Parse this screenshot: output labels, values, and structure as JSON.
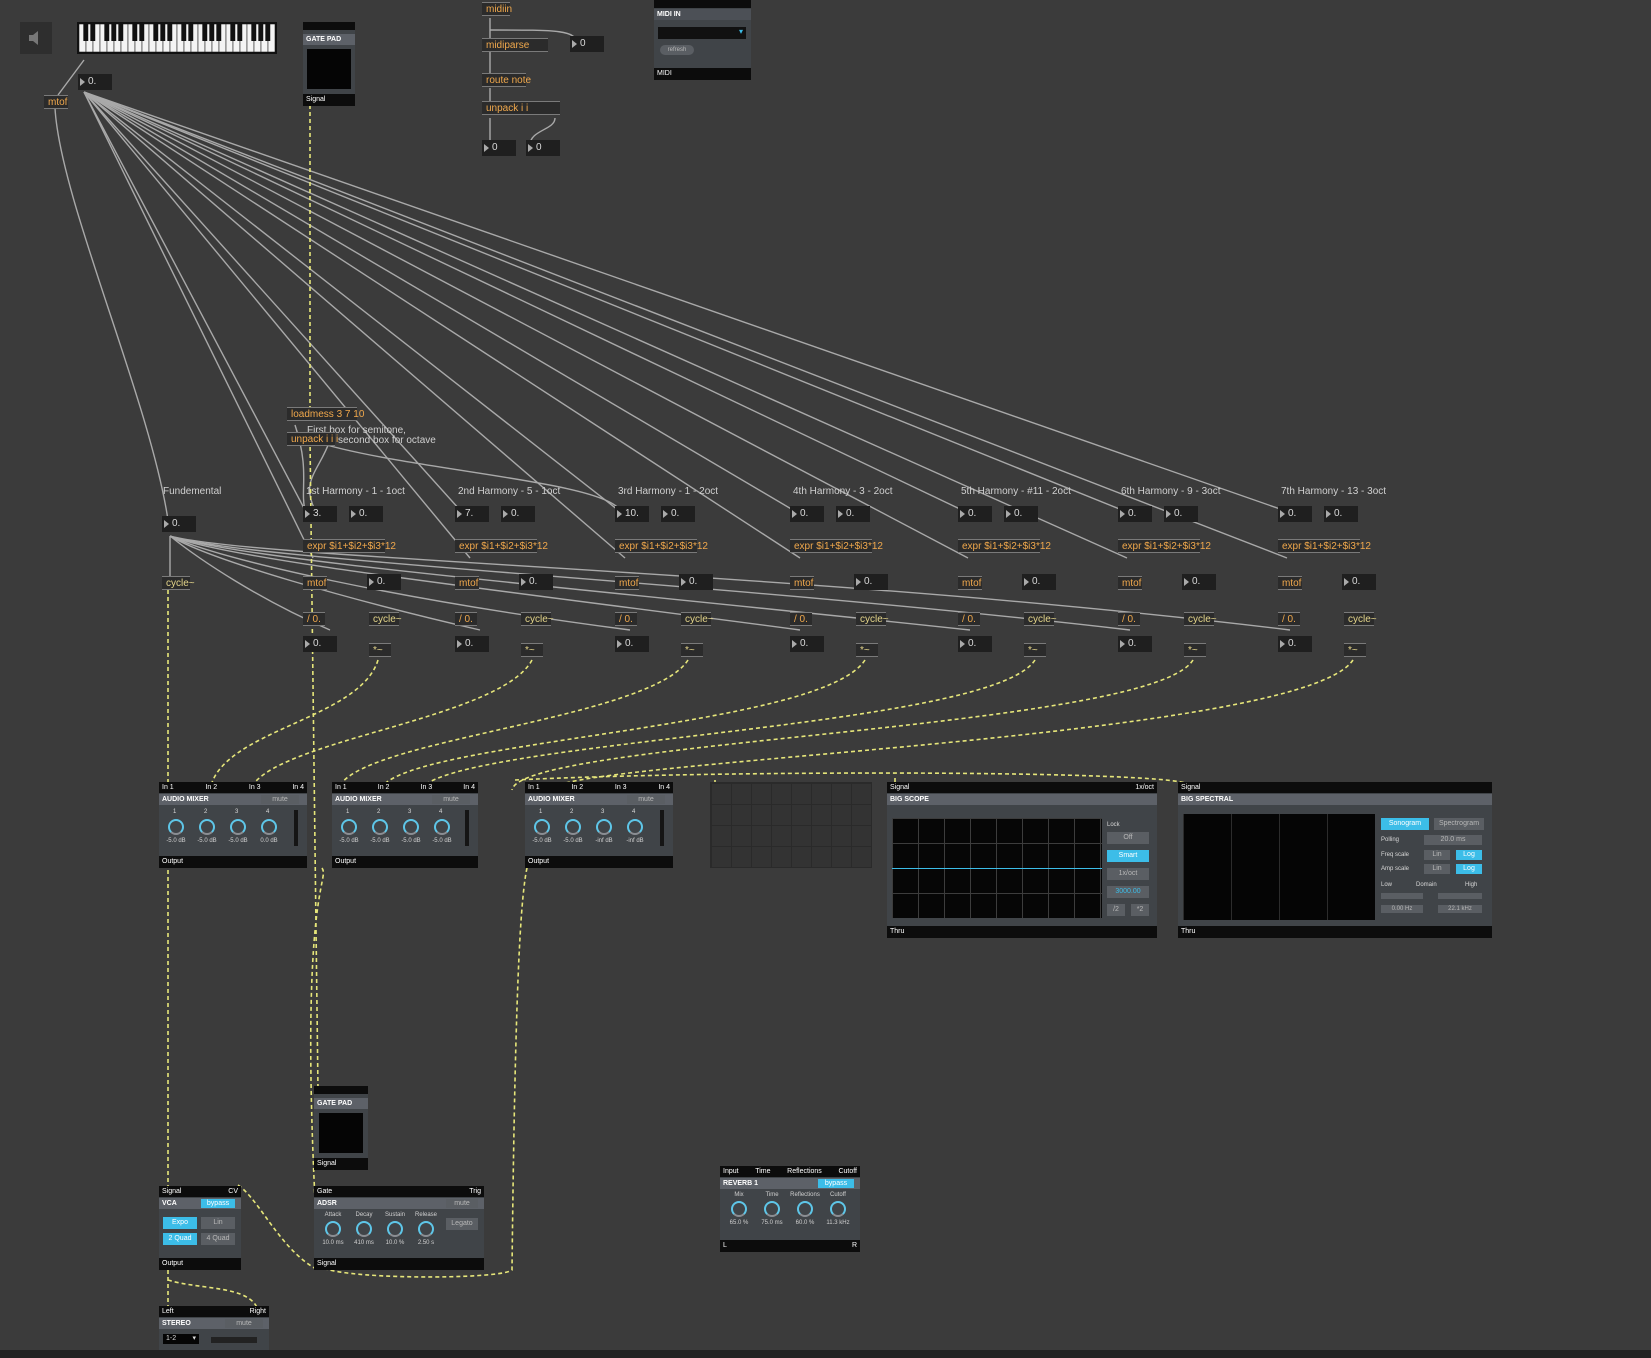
{
  "top": {
    "mtof_label": "mtof",
    "keyboard_num": "0.",
    "midiin": "midiin",
    "midiparse": "midiparse",
    "midiparse_out": "0",
    "route_note": "route note",
    "unpack": "unpack i i",
    "pitch_out": "0",
    "velocity_out": "0"
  },
  "midi_in_panel": {
    "title": "MIDI IN",
    "refresh": "refresh",
    "footer": "MIDI"
  },
  "gate_pad_top": {
    "title": "GATE PAD",
    "footer": "Signal"
  },
  "loadmess": "loadmess 3 7 10",
  "unpack_iii": "unpack i i i",
  "comment_semitone": "First box for semitone,",
  "comment_octave": "second box for octave",
  "fundamental": {
    "label": "Fundemental",
    "num": "0.",
    "cycle": "cycle~"
  },
  "harmonics": [
    {
      "label": "1st Harmony - 1 - 1oct",
      "semi": "3.",
      "oct": "0.",
      "expr": "expr $i1+$i2+$i3*12",
      "mtof": "mtof",
      "mnum": "0.",
      "div": "/ 0.",
      "cycle": "cycle~",
      "divnum": "0.",
      "mult": "*~"
    },
    {
      "label": "2nd Harmony - 5 - 1oct",
      "semi": "7.",
      "oct": "0.",
      "expr": "expr $i1+$i2+$i3*12",
      "mtof": "mtof",
      "mnum": "0.",
      "div": "/ 0.",
      "cycle": "cycle~",
      "divnum": "0.",
      "mult": "*~"
    },
    {
      "label": "3rd Harmony - 1 - 2oct",
      "semi": "10.",
      "oct": "0.",
      "expr": "expr $i1+$i2+$i3*12",
      "mtof": "mtof",
      "mnum": "0.",
      "div": "/ 0.",
      "cycle": "cycle~",
      "divnum": "0.",
      "mult": "*~"
    },
    {
      "label": "4th Harmony - 3 - 2oct",
      "semi": "0.",
      "oct": "0.",
      "expr": "expr $i1+$i2+$i3*12",
      "mtof": "mtof",
      "mnum": "0.",
      "div": "/ 0.",
      "cycle": "cycle~",
      "divnum": "0.",
      "mult": "*~"
    },
    {
      "label": "5th Harmony - #11 - 2oct",
      "semi": "0.",
      "oct": "0.",
      "expr": "expr $i1+$i2+$i3*12",
      "mtof": "mtof",
      "mnum": "0.",
      "div": "/ 0.",
      "cycle": "cycle~",
      "divnum": "0.",
      "mult": "*~"
    },
    {
      "label": "6th Harmony - 9 - 3oct",
      "semi": "0.",
      "oct": "0.",
      "expr": "expr $i1+$i2+$i3*12",
      "mtof": "mtof",
      "mnum": "0.",
      "div": "/ 0.",
      "cycle": "cycle~",
      "divnum": "0.",
      "mult": "*~"
    },
    {
      "label": "7th Harmony - 13 - 3oct",
      "semi": "0.",
      "oct": "0.",
      "expr": "expr $i1+$i2+$i3*12",
      "mtof": "mtof",
      "mnum": "0.",
      "div": "/ 0.",
      "cycle": "cycle~",
      "divnum": "0.",
      "mult": "*~"
    }
  ],
  "mixers": [
    {
      "inputs": [
        "In 1",
        "In 2",
        "In 3",
        "In 4"
      ],
      "title": "AUDIO MIXER",
      "mute": "mute",
      "channels": [
        "1",
        "2",
        "3",
        "4"
      ],
      "levels": [
        "-5.0 dB",
        "-5.0 dB",
        "-5.0 dB",
        "0.0 dB"
      ],
      "footer": "Output"
    },
    {
      "inputs": [
        "In 1",
        "In 2",
        "In 3",
        "In 4"
      ],
      "title": "AUDIO MIXER",
      "mute": "mute",
      "channels": [
        "1",
        "2",
        "3",
        "4"
      ],
      "levels": [
        "-5.0 dB",
        "-5.0 dB",
        "-5.0 dB",
        "-5.0 dB"
      ],
      "footer": "Output"
    },
    {
      "inputs": [
        "In 1",
        "In 2",
        "In 3",
        "In 4"
      ],
      "title": "AUDIO MIXER",
      "mute": "mute",
      "channels": [
        "1",
        "2",
        "3",
        "4"
      ],
      "levels": [
        "-5.0 dB",
        "-5.0 dB",
        "-inf dB",
        "-inf dB"
      ],
      "footer": "Output"
    }
  ],
  "scope": {
    "header_left": "Signal",
    "header_right": "1x/oct",
    "title": "BIG SCOPE",
    "lock": "Lock",
    "off": "Off",
    "smart": "Smart",
    "oct": "1x/oct",
    "value": "3000.00",
    "half": "/2",
    "double": "*2",
    "footer": "Thru",
    "accent": "#3cbde8"
  },
  "spectral": {
    "header_left": "Signal",
    "title": "BIG SPECTRAL",
    "sonogram": "Sonogram",
    "spectrogram": "Spectrogram",
    "polling": "Polling",
    "polling_value": "20.0 ms",
    "freq_scale": "Freq scale",
    "amp_scale": "Amp scale",
    "lin": "Lin",
    "log": "Log",
    "low": "Low",
    "domain": "Domain",
    "high": "High",
    "low_value": "0.00 Hz",
    "high_value": "22.1 kHz",
    "footer": "Thru"
  },
  "gate_pad_bottom": {
    "title": "GATE PAD",
    "footer": "Signal"
  },
  "vca": {
    "header_left": "Signal",
    "header_right": "CV",
    "title": "VCA",
    "bypass": "bypass",
    "expo": "Expo",
    "lin": "Lin",
    "quad2": "2 Quad",
    "quad4": "4 Quad",
    "footer": "Output"
  },
  "adsr": {
    "header_left": "Gate",
    "header_right": "Trig",
    "title": "ADSR",
    "mute": "mute",
    "knobs": [
      "Attack",
      "Decay",
      "Sustain",
      "Release"
    ],
    "values": [
      "10.0 ms",
      "410 ms",
      "10.0 %",
      "2.50 s"
    ],
    "legato": "Legato",
    "footer": "Signal"
  },
  "reverb": {
    "inputs": [
      "Input",
      "Time",
      "Reflections",
      "Cutoff"
    ],
    "title": "REVERB 1",
    "bypass": "bypass",
    "knobs": [
      "Mix",
      "Time",
      "Reflections",
      "Cutoff"
    ],
    "values": [
      "65.0 %",
      "75.0 ms",
      "60.0 %",
      "11.3 kHz"
    ],
    "footer_left": "L",
    "footer_right": "R"
  },
  "stereo": {
    "header_left": "Left",
    "header_right": "Right",
    "title": "STEREO",
    "mute": "mute",
    "channel": "1-2"
  }
}
